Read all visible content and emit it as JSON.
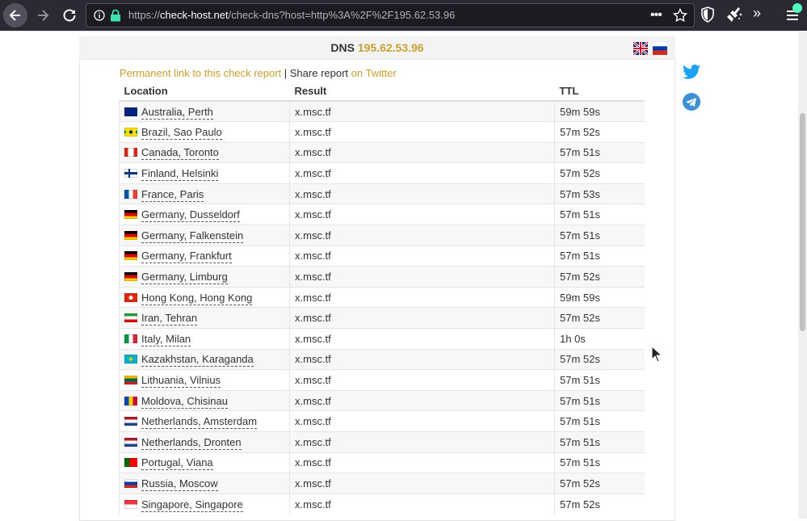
{
  "browser": {
    "url_scheme": "https://",
    "url_host": "check-host.net",
    "url_path": "/check-dns?host=http%3A%2F%2F195.62.53.96",
    "more_icon": "•••"
  },
  "panel": {
    "title_prefix": "DNS",
    "title_host": "195.62.53.96"
  },
  "links": {
    "permanent": "Permanent link to this check report",
    "separator": " | ",
    "share": "Share report",
    "twitter": "on Twitter"
  },
  "table": {
    "headers": [
      "Location",
      "Result",
      "TTL"
    ],
    "rows": [
      {
        "location": "Australia, Perth",
        "result": "x.msc.tf",
        "ttl": "59m 59s",
        "flag": "au"
      },
      {
        "location": "Brazil, Sao Paulo",
        "result": "x.msc.tf",
        "ttl": "57m 52s",
        "flag": "br"
      },
      {
        "location": "Canada, Toronto",
        "result": "x.msc.tf",
        "ttl": "57m 51s",
        "flag": "ca"
      },
      {
        "location": "Finland, Helsinki",
        "result": "x.msc.tf",
        "ttl": "57m 52s",
        "flag": "fi"
      },
      {
        "location": "France, Paris",
        "result": "x.msc.tf",
        "ttl": "57m 53s",
        "flag": "fr"
      },
      {
        "location": "Germany, Dusseldorf",
        "result": "x.msc.tf",
        "ttl": "57m 51s",
        "flag": "de"
      },
      {
        "location": "Germany, Falkenstein",
        "result": "x.msc.tf",
        "ttl": "57m 51s",
        "flag": "de"
      },
      {
        "location": "Germany, Frankfurt",
        "result": "x.msc.tf",
        "ttl": "57m 51s",
        "flag": "de"
      },
      {
        "location": "Germany, Limburg",
        "result": "x.msc.tf",
        "ttl": "57m 52s",
        "flag": "de"
      },
      {
        "location": "Hong Kong, Hong Kong",
        "result": "x.msc.tf",
        "ttl": "59m 59s",
        "flag": "hk"
      },
      {
        "location": "Iran, Tehran",
        "result": "x.msc.tf",
        "ttl": "57m 52s",
        "flag": "ir"
      },
      {
        "location": "Italy, Milan",
        "result": "x.msc.tf",
        "ttl": "1h 0s",
        "flag": "it"
      },
      {
        "location": "Kazakhstan, Karaganda",
        "result": "x.msc.tf",
        "ttl": "57m 52s",
        "flag": "kz"
      },
      {
        "location": "Lithuania, Vilnius",
        "result": "x.msc.tf",
        "ttl": "57m 51s",
        "flag": "lt"
      },
      {
        "location": "Moldova, Chisinau",
        "result": "x.msc.tf",
        "ttl": "57m 51s",
        "flag": "md"
      },
      {
        "location": "Netherlands, Amsterdam",
        "result": "x.msc.tf",
        "ttl": "57m 51s",
        "flag": "nl"
      },
      {
        "location": "Netherlands, Dronten",
        "result": "x.msc.tf",
        "ttl": "57m 51s",
        "flag": "nl"
      },
      {
        "location": "Portugal, Viana",
        "result": "x.msc.tf",
        "ttl": "57m 51s",
        "flag": "pt"
      },
      {
        "location": "Russia, Moscow",
        "result": "x.msc.tf",
        "ttl": "57m 52s",
        "flag": "ru"
      },
      {
        "location": "Singapore, Singapore",
        "result": "x.msc.tf",
        "ttl": "57m 52s",
        "flag": "sg"
      }
    ]
  },
  "colors": {
    "accent": "#c8a030",
    "toolbar_bg": "#2b2a33",
    "twitter": "#1da1f2",
    "telegram": "#3d8fd6"
  }
}
